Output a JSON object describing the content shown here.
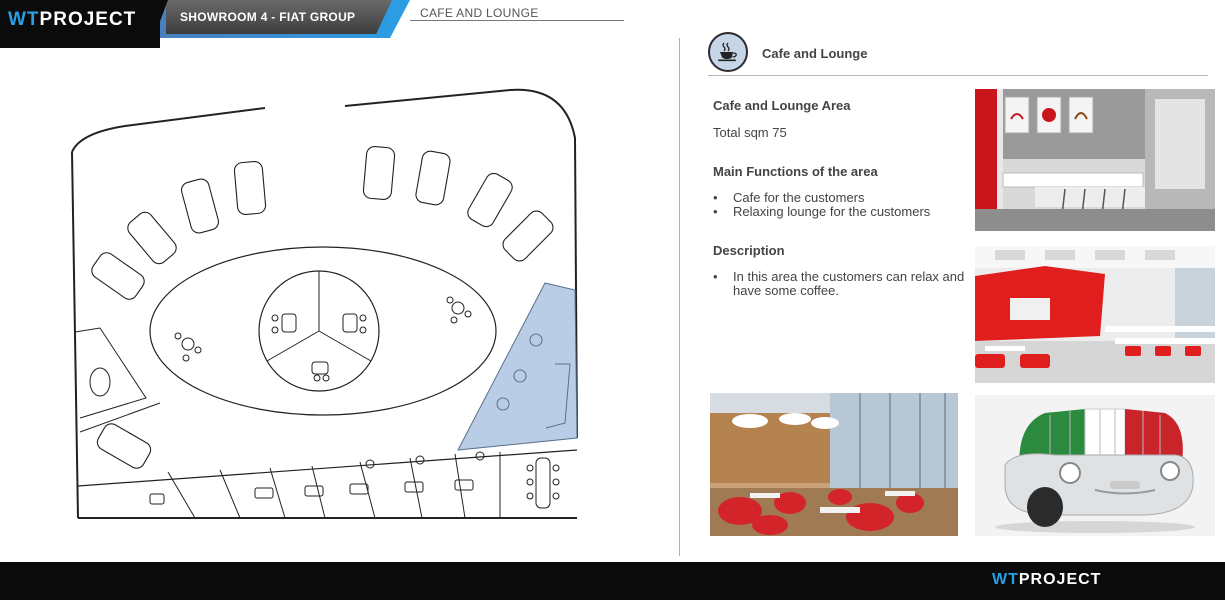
{
  "header": {
    "logo_wt": "WT",
    "logo_project": "PROJECT",
    "showroom_title": "SHOWROOM  4  -  FIAT GROUP",
    "section_title": "CAFE AND LOUNGE"
  },
  "panel": {
    "icon": "coffee-cup-icon",
    "heading": "Cafe and Lounge",
    "area_title": "Cafe and Lounge Area",
    "total_sqm": "Total sqm  75",
    "functions_title": "Main Functions of the area",
    "functions": [
      "Cafe for the customers",
      "Relaxing lounge for the customers"
    ],
    "description_title": "Description",
    "description": [
      "In this area the customers can relax and have  some coffee."
    ]
  },
  "photos": {
    "top_right": "cafe-bar-photo",
    "mid_right": "red-canteen-photo",
    "bottom_left": "restaurant-seating-photo",
    "bottom_right": "fiat-500-sofa-photo"
  },
  "footer": {
    "logo_wt": "WT",
    "logo_project": "PROJECT"
  },
  "colors": {
    "accent_blue": "#2a9ee6",
    "highlight_area": "#b9cde6",
    "dark": "#0b0b0b"
  }
}
